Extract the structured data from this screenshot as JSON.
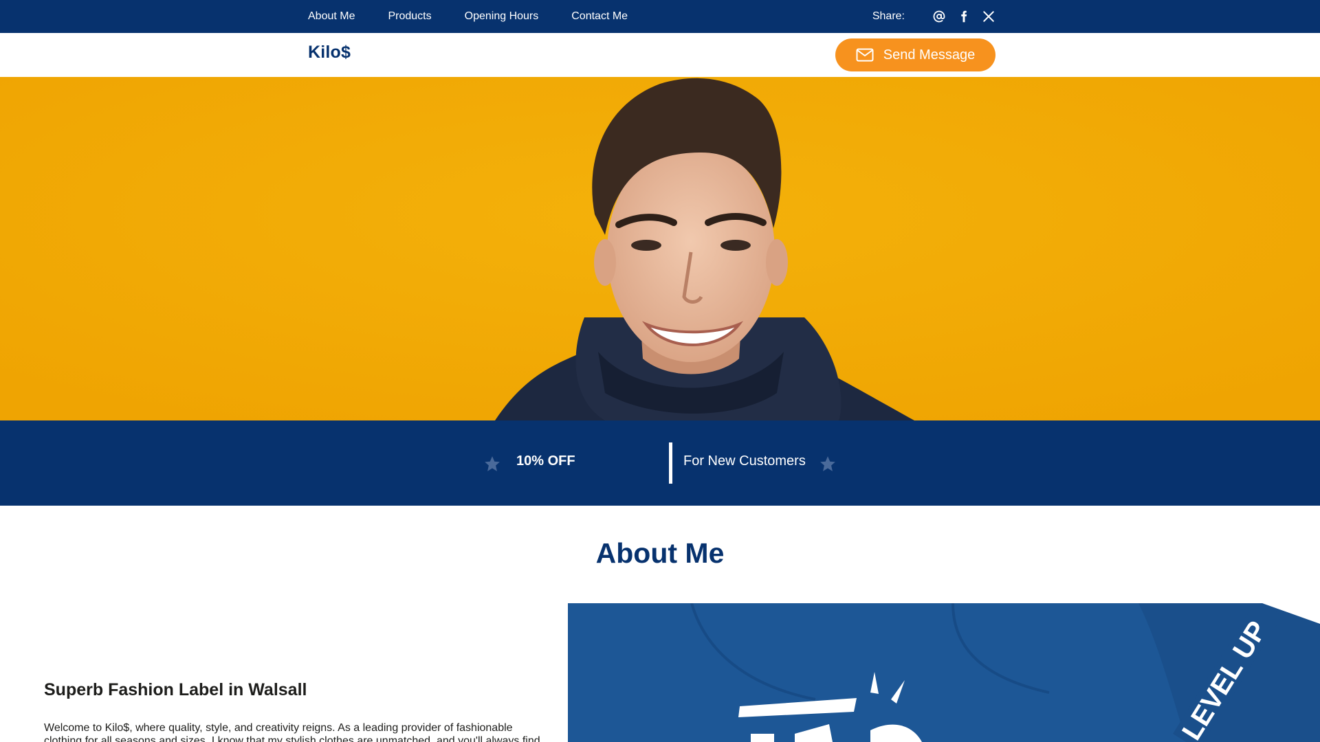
{
  "topbar": {
    "nav": [
      "About Me",
      "Products",
      "Opening Hours",
      "Contact Me"
    ],
    "share_label": "Share:",
    "share_icons": [
      "at-icon",
      "facebook-icon",
      "x-icon"
    ]
  },
  "header": {
    "logo": "Kilo$",
    "send_button": "Send Message"
  },
  "hero": {
    "image": "smiling man in navy hoodie on yellow background"
  },
  "promo": {
    "left": "10% OFF",
    "right": "For New Customers"
  },
  "about": {
    "title": "About Me",
    "subtitle": "Superb Fashion Label in Walsall",
    "text": "Welcome to Kilo$, where quality, style, and creativity reigns. As a leading provider of fashionable clothing for all seasons and sizes, I know that my stylish clothes are unmatched, and you'll always find something",
    "image": "blue sweatshirt with Kilo$ print"
  },
  "colors": {
    "navy": "#07326e",
    "accent": "#f7921e",
    "hero_bg": "#f2ab05",
    "star": "#4a6a9a"
  }
}
